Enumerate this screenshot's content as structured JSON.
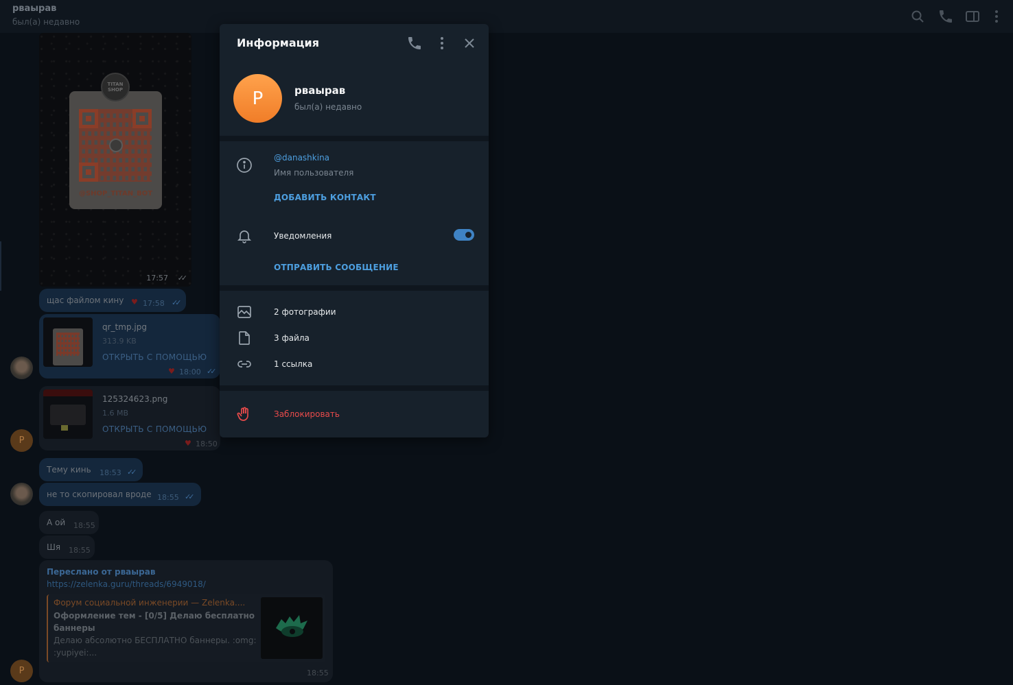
{
  "header": {
    "title": "рваырав",
    "status": "был(а) недавно"
  },
  "messages": {
    "photo_logo": "TITAN SHOP",
    "photo_qr_label": "@SHOP_TITAN_BOT",
    "photo_time": "17:57",
    "m1_text": "щас файлом кину",
    "m1_time": "17:58",
    "file1_name": "qr_tmp.jpg",
    "file1_size": "313.9 KB",
    "file1_open": "ОТКРЫТЬ С ПОМОЩЬЮ",
    "file1_time": "18:00",
    "file2_name": "125324623.png",
    "file2_size": "1.6 MB",
    "file2_open": "ОТКРЫТЬ С ПОМОЩЬЮ",
    "file2_time": "18:50",
    "avatar_letter": "P",
    "m2_text": "Тему кинь",
    "m2_time": "18:53",
    "m3_text": "не то скопировал вроде",
    "m3_time": "18:55",
    "m4_text": "А ой",
    "m4_time": "18:55",
    "m5_text": "Шя",
    "m5_time": "18:55",
    "fwd_from": "Переслано от рваырав",
    "fwd_link": "https://zelenka.guru/threads/6949018/",
    "preview_title": "Форум социальной инженерии — Zelenka....",
    "preview_subtitle": "Оформление тем - [0/5] Делаю бесплатно баннеры",
    "preview_desc": "Делаю абсолютно БЕСПЛАТНО баннеры. :omg: :yupiyei:...",
    "fwd_time": "18:55"
  },
  "panel": {
    "title": "Информация",
    "avatar_letter": "P",
    "name": "рваырав",
    "status": "был(а) недавно",
    "username": "@danashkina",
    "username_label": "Имя пользователя",
    "add_contact": "ДОБАВИТЬ КОНТАКТ",
    "notifications_label": "Уведомления",
    "notifications_enabled": true,
    "send_message": "ОТПРАВИТЬ СООБЩЕНИЕ",
    "photos": "2 фотографии",
    "files": "3 файла",
    "links": "1 ссылка",
    "block": "Заблокировать"
  },
  "colors": {
    "panel_bg": "#17212b",
    "accent": "#4d9fe0",
    "danger": "#e94b4b",
    "avatar_orange": "#f7932f"
  }
}
